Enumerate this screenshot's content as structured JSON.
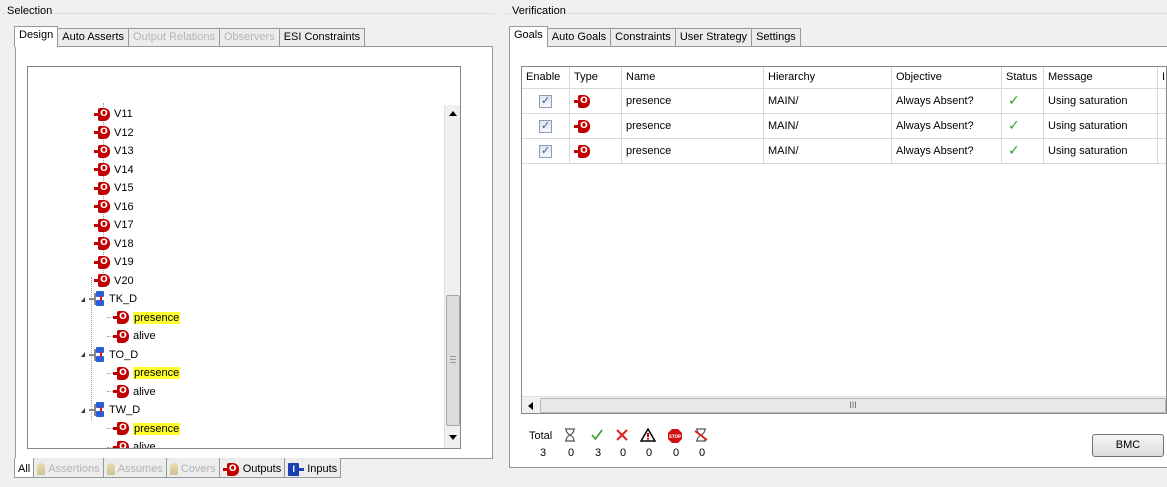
{
  "selection": {
    "group_label": "Selection",
    "tabs": [
      {
        "label": "Design",
        "state": "active"
      },
      {
        "label": "Auto Asserts",
        "state": "normal"
      },
      {
        "label": "Output Relations",
        "state": "disabled"
      },
      {
        "label": "Observers",
        "state": "disabled"
      },
      {
        "label": "ESI Constraints",
        "state": "normal"
      }
    ],
    "tree": {
      "signals": [
        "V11",
        "V12",
        "V13",
        "V14",
        "V15",
        "V16",
        "V17",
        "V18",
        "V19",
        "V20"
      ],
      "modules": [
        {
          "name": "TK_D",
          "children": [
            {
              "label": "presence",
              "highlighted": true
            },
            {
              "label": "alive",
              "highlighted": false
            }
          ]
        },
        {
          "name": "TO_D",
          "children": [
            {
              "label": "presence",
              "highlighted": true
            },
            {
              "label": "alive",
              "highlighted": false
            }
          ]
        },
        {
          "name": "TW_D",
          "children": [
            {
              "label": "presence",
              "highlighted": true
            },
            {
              "label": "alive",
              "highlighted": false
            }
          ]
        }
      ],
      "output_icon_letter": "O"
    },
    "filter_tabs": [
      {
        "label": "All",
        "state": "active",
        "icon": ""
      },
      {
        "label": "Assertions",
        "state": "disabled",
        "icon": "assertion-icon"
      },
      {
        "label": "Assumes",
        "state": "disabled",
        "icon": "assume-icon"
      },
      {
        "label": "Covers",
        "state": "disabled",
        "icon": "cover-icon"
      },
      {
        "label": "Outputs",
        "state": "normal",
        "icon": "output-icon"
      },
      {
        "label": "Inputs",
        "state": "normal",
        "icon": "input-icon"
      }
    ],
    "input_icon_letter": "I"
  },
  "verification": {
    "group_label": "Verification",
    "tabs": [
      {
        "label": "Goals",
        "state": "active"
      },
      {
        "label": "Auto Goals",
        "state": "normal"
      },
      {
        "label": "Constraints",
        "state": "normal"
      },
      {
        "label": "User Strategy",
        "state": "normal"
      },
      {
        "label": "Settings",
        "state": "normal"
      }
    ],
    "grid": {
      "columns": [
        "Enable",
        "Type",
        "Name",
        "Hierarchy",
        "Objective",
        "Status",
        "Message",
        "I"
      ],
      "rows": [
        {
          "enabled": true,
          "type_icon": "output-icon",
          "name": "presence",
          "hierarchy": "MAIN/",
          "objective": "Always Absent?",
          "status": "✓",
          "message": "Using saturation"
        },
        {
          "enabled": true,
          "type_icon": "output-icon",
          "name": "presence",
          "hierarchy": "MAIN/",
          "objective": "Always Absent?",
          "status": "✓",
          "message": "Using saturation"
        },
        {
          "enabled": true,
          "type_icon": "output-icon",
          "name": "presence",
          "hierarchy": "MAIN/",
          "objective": "Always Absent?",
          "status": "✓",
          "message": "Using saturation"
        }
      ],
      "hscroll_label": "III"
    },
    "summary": {
      "total_label": "Total",
      "total": "3",
      "items": [
        {
          "icon": "hourglass-icon",
          "count": "0"
        },
        {
          "icon": "check-icon",
          "count": "3"
        },
        {
          "icon": "cross-icon",
          "count": "0"
        },
        {
          "icon": "warning-icon",
          "count": "0"
        },
        {
          "icon": "stop-icon",
          "count": "0"
        },
        {
          "icon": "hourglass-crossed-icon",
          "count": "0"
        }
      ]
    },
    "bmc_button": "BMC"
  },
  "colors": {
    "output_red": "#c00000",
    "highlight": "#ffff30",
    "check_green": "#2e9e2e",
    "module_blue": "#2a5ed8"
  }
}
